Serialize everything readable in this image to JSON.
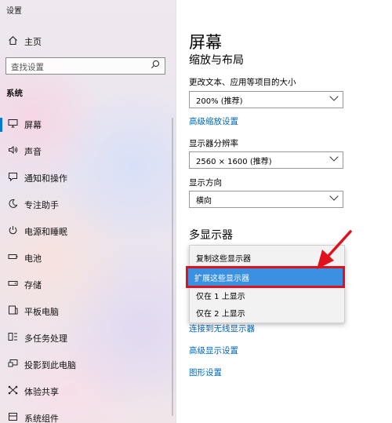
{
  "window": {
    "title": "设置"
  },
  "sidebar": {
    "home": "主页",
    "search": {
      "placeholder": "查找设置",
      "value": ""
    },
    "section": "系统",
    "items": [
      {
        "label": "屏幕",
        "icon": "monitor-icon",
        "selected": true
      },
      {
        "label": "声音",
        "icon": "speaker-icon"
      },
      {
        "label": "通知和操作",
        "icon": "notification-icon"
      },
      {
        "label": "专注助手",
        "icon": "moon-icon"
      },
      {
        "label": "电源和睡眠",
        "icon": "power-icon"
      },
      {
        "label": "电池",
        "icon": "battery-icon"
      },
      {
        "label": "存储",
        "icon": "storage-icon"
      },
      {
        "label": "平板电脑",
        "icon": "tablet-icon"
      },
      {
        "label": "多任务处理",
        "icon": "multitask-icon"
      },
      {
        "label": "投影到此电脑",
        "icon": "project-icon"
      },
      {
        "label": "体验共享",
        "icon": "share-icon"
      },
      {
        "label": "系统组件",
        "icon": "components-icon"
      }
    ]
  },
  "main": {
    "title": "屏幕",
    "scale_section": "缩放与布局",
    "scale_label": "更改文本、应用等项目的大小",
    "scale_value": "200% (推荐)",
    "advanced_scaling_link": "高级缩放设置",
    "resolution_label": "显示器分辨率",
    "resolution_value": "2560 × 1600 (推荐)",
    "orientation_label": "显示方向",
    "orientation_value": "横向",
    "multi_display_title": "多显示器",
    "multi_display_options": [
      "复制这些显示器",
      "扩展这些显示器",
      "仅在 1 上显示",
      "仅在 2 上显示"
    ],
    "multi_display_selected": "扩展这些显示器",
    "wireless_link": "连接到无线显示器",
    "advanced_display_link": "高级显示设置",
    "graphics_link": "图形设置"
  },
  "colors": {
    "accent": "#0078d7",
    "link": "#0067c0",
    "highlight": "#3a91e2",
    "annotation": "#e0101c"
  }
}
